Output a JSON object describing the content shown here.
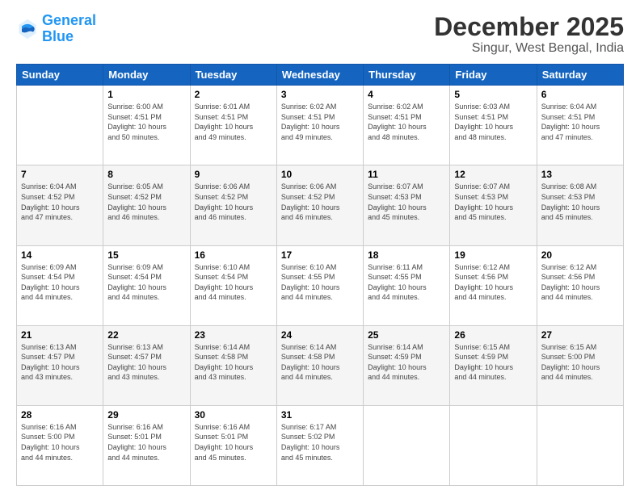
{
  "header": {
    "logo_line1": "General",
    "logo_line2": "Blue",
    "title": "December 2025",
    "subtitle": "Singur, West Bengal, India"
  },
  "calendar": {
    "headers": [
      "Sunday",
      "Monday",
      "Tuesday",
      "Wednesday",
      "Thursday",
      "Friday",
      "Saturday"
    ],
    "weeks": [
      [
        {
          "day": "",
          "detail": ""
        },
        {
          "day": "1",
          "detail": "Sunrise: 6:00 AM\nSunset: 4:51 PM\nDaylight: 10 hours\nand 50 minutes."
        },
        {
          "day": "2",
          "detail": "Sunrise: 6:01 AM\nSunset: 4:51 PM\nDaylight: 10 hours\nand 49 minutes."
        },
        {
          "day": "3",
          "detail": "Sunrise: 6:02 AM\nSunset: 4:51 PM\nDaylight: 10 hours\nand 49 minutes."
        },
        {
          "day": "4",
          "detail": "Sunrise: 6:02 AM\nSunset: 4:51 PM\nDaylight: 10 hours\nand 48 minutes."
        },
        {
          "day": "5",
          "detail": "Sunrise: 6:03 AM\nSunset: 4:51 PM\nDaylight: 10 hours\nand 48 minutes."
        },
        {
          "day": "6",
          "detail": "Sunrise: 6:04 AM\nSunset: 4:51 PM\nDaylight: 10 hours\nand 47 minutes."
        }
      ],
      [
        {
          "day": "7",
          "detail": "Sunrise: 6:04 AM\nSunset: 4:52 PM\nDaylight: 10 hours\nand 47 minutes."
        },
        {
          "day": "8",
          "detail": "Sunrise: 6:05 AM\nSunset: 4:52 PM\nDaylight: 10 hours\nand 46 minutes."
        },
        {
          "day": "9",
          "detail": "Sunrise: 6:06 AM\nSunset: 4:52 PM\nDaylight: 10 hours\nand 46 minutes."
        },
        {
          "day": "10",
          "detail": "Sunrise: 6:06 AM\nSunset: 4:52 PM\nDaylight: 10 hours\nand 46 minutes."
        },
        {
          "day": "11",
          "detail": "Sunrise: 6:07 AM\nSunset: 4:53 PM\nDaylight: 10 hours\nand 45 minutes."
        },
        {
          "day": "12",
          "detail": "Sunrise: 6:07 AM\nSunset: 4:53 PM\nDaylight: 10 hours\nand 45 minutes."
        },
        {
          "day": "13",
          "detail": "Sunrise: 6:08 AM\nSunset: 4:53 PM\nDaylight: 10 hours\nand 45 minutes."
        }
      ],
      [
        {
          "day": "14",
          "detail": "Sunrise: 6:09 AM\nSunset: 4:54 PM\nDaylight: 10 hours\nand 44 minutes."
        },
        {
          "day": "15",
          "detail": "Sunrise: 6:09 AM\nSunset: 4:54 PM\nDaylight: 10 hours\nand 44 minutes."
        },
        {
          "day": "16",
          "detail": "Sunrise: 6:10 AM\nSunset: 4:54 PM\nDaylight: 10 hours\nand 44 minutes."
        },
        {
          "day": "17",
          "detail": "Sunrise: 6:10 AM\nSunset: 4:55 PM\nDaylight: 10 hours\nand 44 minutes."
        },
        {
          "day": "18",
          "detail": "Sunrise: 6:11 AM\nSunset: 4:55 PM\nDaylight: 10 hours\nand 44 minutes."
        },
        {
          "day": "19",
          "detail": "Sunrise: 6:12 AM\nSunset: 4:56 PM\nDaylight: 10 hours\nand 44 minutes."
        },
        {
          "day": "20",
          "detail": "Sunrise: 6:12 AM\nSunset: 4:56 PM\nDaylight: 10 hours\nand 44 minutes."
        }
      ],
      [
        {
          "day": "21",
          "detail": "Sunrise: 6:13 AM\nSunset: 4:57 PM\nDaylight: 10 hours\nand 43 minutes."
        },
        {
          "day": "22",
          "detail": "Sunrise: 6:13 AM\nSunset: 4:57 PM\nDaylight: 10 hours\nand 43 minutes."
        },
        {
          "day": "23",
          "detail": "Sunrise: 6:14 AM\nSunset: 4:58 PM\nDaylight: 10 hours\nand 43 minutes."
        },
        {
          "day": "24",
          "detail": "Sunrise: 6:14 AM\nSunset: 4:58 PM\nDaylight: 10 hours\nand 44 minutes."
        },
        {
          "day": "25",
          "detail": "Sunrise: 6:14 AM\nSunset: 4:59 PM\nDaylight: 10 hours\nand 44 minutes."
        },
        {
          "day": "26",
          "detail": "Sunrise: 6:15 AM\nSunset: 4:59 PM\nDaylight: 10 hours\nand 44 minutes."
        },
        {
          "day": "27",
          "detail": "Sunrise: 6:15 AM\nSunset: 5:00 PM\nDaylight: 10 hours\nand 44 minutes."
        }
      ],
      [
        {
          "day": "28",
          "detail": "Sunrise: 6:16 AM\nSunset: 5:00 PM\nDaylight: 10 hours\nand 44 minutes."
        },
        {
          "day": "29",
          "detail": "Sunrise: 6:16 AM\nSunset: 5:01 PM\nDaylight: 10 hours\nand 44 minutes."
        },
        {
          "day": "30",
          "detail": "Sunrise: 6:16 AM\nSunset: 5:01 PM\nDaylight: 10 hours\nand 45 minutes."
        },
        {
          "day": "31",
          "detail": "Sunrise: 6:17 AM\nSunset: 5:02 PM\nDaylight: 10 hours\nand 45 minutes."
        },
        {
          "day": "",
          "detail": ""
        },
        {
          "day": "",
          "detail": ""
        },
        {
          "day": "",
          "detail": ""
        }
      ]
    ]
  }
}
